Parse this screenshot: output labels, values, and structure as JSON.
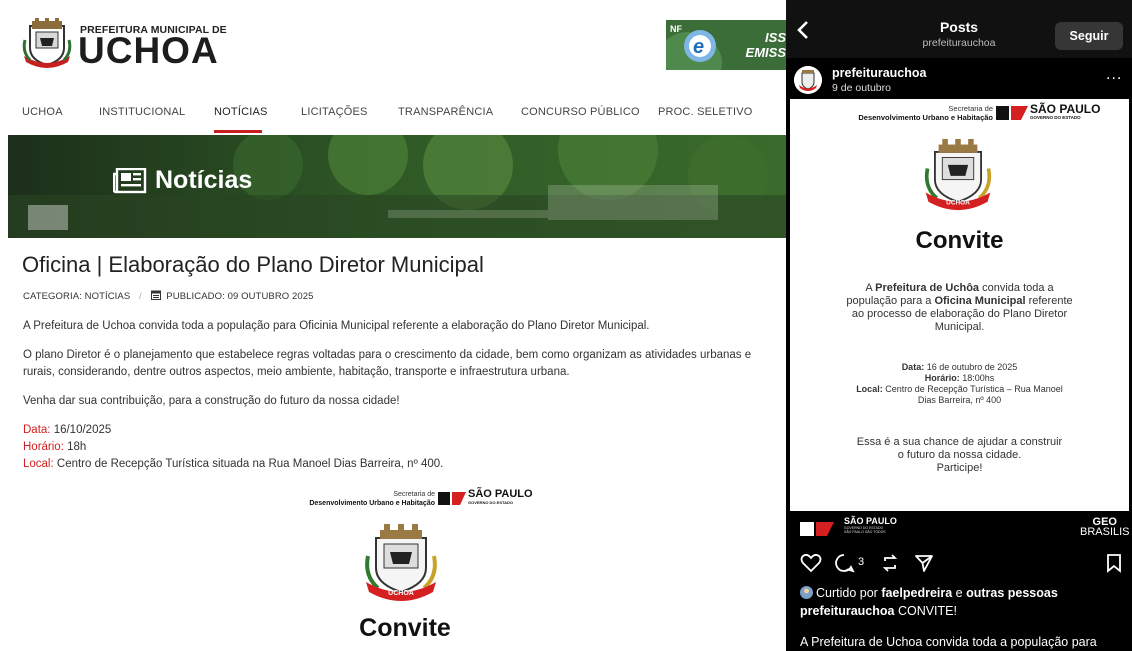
{
  "site": {
    "logo_small": "PREFEITURA MUNICIPAL DE",
    "logo_big": "UCHOA",
    "banner_text_1": "ISS",
    "banner_text_2": "EMISS",
    "nav": [
      "UCHOA",
      "INSTITUCIONAL",
      "NOTÍCIAS",
      "LICITAÇÕES",
      "TRANSPARÊNCIA",
      "CONCURSO PÚBLICO",
      "PROC. SELETIVO"
    ],
    "hero_title": "Notícias",
    "article_title": "Oficina | Elaboração do Plano Diretor Municipal",
    "meta_category": "CATEGORIA: NOTÍCIAS",
    "meta_sep": "/",
    "meta_published": "PUBLICADO: 09 OUTUBRO 2025",
    "p1": "A Prefeitura de Uchoa convida toda a população para Oficinia Municipal referente a elaboração do Plano Diretor Municipal.",
    "p2": "O plano Diretor é o planejamento que estabelece regras voltadas para o crescimento da cidade, bem como organizam as atividades urbanas e rurais, considerando, dentre outros aspectos, meio ambiente, habitação, transporte e infraestrutura urbana.",
    "p3": "Venha dar sua contribuição, para a construção do futuro da nossa cidade!",
    "data_label": "Data:",
    "data_value": " 16/10/2025",
    "horario_label": "Horário:",
    "horario_value": " 18h",
    "local_label": "Local:",
    "local_value": " Centro de Recepção Turística situada na Rua Manoel Dias Barreira, nº 400.",
    "poster_secretaria": "Secretaria de",
    "poster_secretaria_2": "Desenvolvimento Urbano e Habitação",
    "poster_sp": "SÃO PAULO",
    "poster_sp_sub": "GOVERNO DO ESTADO",
    "poster_title": "Convite",
    "crest_band": "UCHOA"
  },
  "instagram": {
    "back": "<",
    "header_title": "Posts",
    "header_sub": "prefeiturauchoa",
    "follow": "Seguir",
    "username": "prefeiturauchoa",
    "date": "9 de outubro",
    "more": "...",
    "poster": {
      "secretaria": "Secretaria de",
      "secretaria_2": "Desenvolvimento Urbano e Habitação",
      "sp": "SÃO PAULO",
      "sp_sub": "GOVERNO DO ESTADO",
      "title": "Convite",
      "line1_a": "A ",
      "line1_b": "Prefeitura de Uchôa",
      "line1_c": " convida toda a",
      "line2_a": "população para a ",
      "line2_b": "Oficina Municipal",
      "line2_c": " referente",
      "line3": "ao processo de elaboração do Plano Diretor",
      "line4": "Municipal.",
      "data_label": "Data:",
      "data_value": " 16 de outubro de 2025",
      "horario_label": "Horário:",
      "horario_value": " 18:00hs",
      "local_label": "Local:",
      "local_value": " Centro de Recepção Turística – Rua Manoel",
      "local_value_2": "Dias Barreira, nº 400",
      "closing1": "Essa é a sua chance de ajudar a construir",
      "closing2": "o futuro da nossa cidade.",
      "closing3": "Participe!",
      "crest_band": "UCHOA"
    },
    "footer_sp": "SÃO PAULO",
    "footer_sp_sub": "GOVERNO DO ESTADO",
    "footer_sp_sub2": "SÃO PAULO SÃO TODOS",
    "footer_geo": "GEO",
    "footer_brasilis": "BRASILIS",
    "comment_count": "3",
    "liked_prefix": "Curtido por ",
    "liked_user": "faelpedreira",
    "liked_mid": " e ",
    "liked_rest": "outras pessoas",
    "caption_user": "prefeiturauchoa",
    "caption_text": " CONVITE!",
    "caption_line2": "A Prefeitura de Uchoa convida toda a  população  para"
  },
  "colors": {
    "accent_red": "#c61f1f",
    "label_red": "#d42020",
    "ig_bg": "#000000"
  }
}
